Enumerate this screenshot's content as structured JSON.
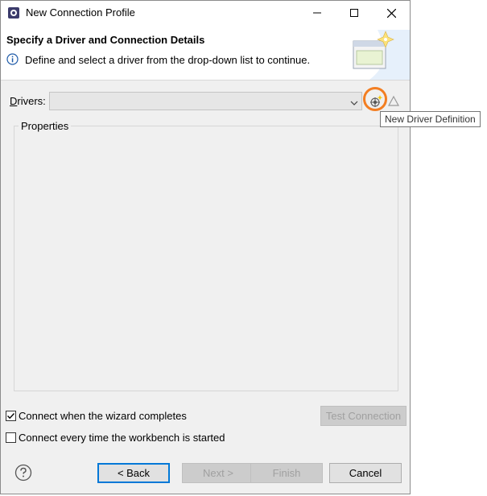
{
  "window": {
    "title": "New Connection Profile"
  },
  "header": {
    "title": "Specify a Driver and Connection Details",
    "description": "Define and select a driver from the drop-down list to continue."
  },
  "drivers": {
    "label_prefix": "",
    "label_mnemonic": "D",
    "label_rest": "rivers:",
    "selected": ""
  },
  "tooltip": {
    "text": "New Driver Definition"
  },
  "properties": {
    "legend": "Properties"
  },
  "options": {
    "connect_on_finish": {
      "label": "Connect when the wizard completes",
      "checked": true
    },
    "connect_on_startup": {
      "label": "Connect every time the workbench is started",
      "checked": false
    }
  },
  "buttons": {
    "test_connection": "Test Connection",
    "back": "< Back",
    "next": "Next >",
    "finish": "Finish",
    "cancel": "Cancel"
  },
  "colors": {
    "highlight_ring": "#f37e22",
    "default_button_border": "#0078d7"
  },
  "icons": {
    "app": "app-icon",
    "info": "info-icon",
    "help": "help-icon",
    "new_driver": "new-driver-icon",
    "edit_driver": "edit-driver-icon",
    "banner": "wizard-banner-icon"
  }
}
